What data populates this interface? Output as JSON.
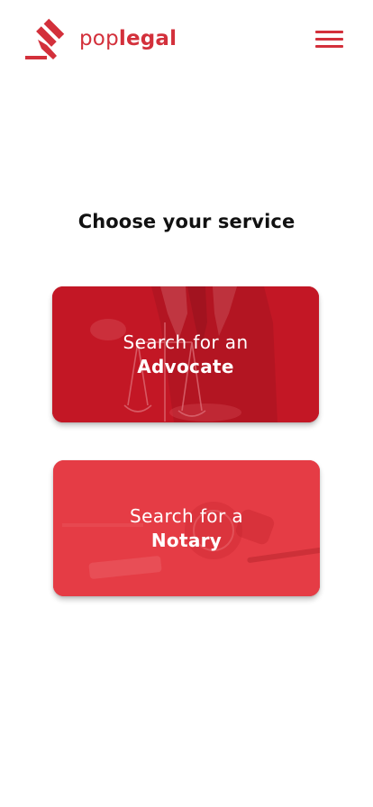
{
  "brand": {
    "name_light": "pop",
    "name_bold": "legal",
    "accent_color": "#d3303b"
  },
  "header": {
    "menu_icon": "hamburger-menu-icon"
  },
  "main": {
    "heading": "Choose your service",
    "services": [
      {
        "line1": "Search for an",
        "line2": "Advocate",
        "background": "judge-with-scales-photo"
      },
      {
        "line1": "Search for a",
        "line2": "Notary",
        "background": "notary-stamp-and-pen-photo"
      }
    ]
  }
}
